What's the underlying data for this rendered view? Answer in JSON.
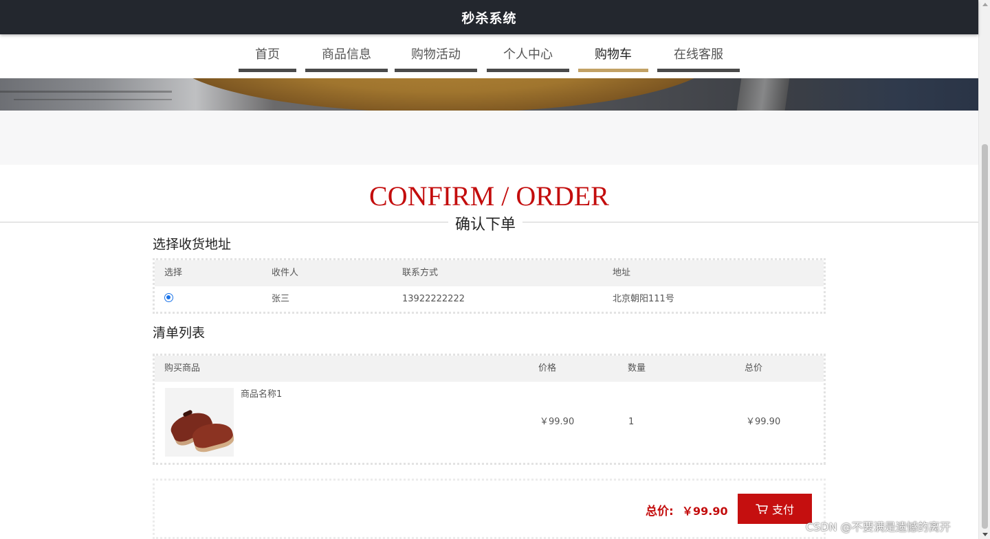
{
  "header": {
    "title": "秒杀系统"
  },
  "nav": {
    "items": [
      {
        "label": "首页",
        "active": false
      },
      {
        "label": "商品信息",
        "active": false
      },
      {
        "label": "购物活动",
        "active": false
      },
      {
        "label": "个人中心",
        "active": false
      },
      {
        "label": "购物车",
        "active": true
      },
      {
        "label": "在线客服",
        "active": false
      }
    ],
    "active_color": "#c2a165",
    "inactive_color": "#4a4a4a"
  },
  "page_heading": {
    "en": "CONFIRM / ORDER",
    "cn": "确认下单"
  },
  "address": {
    "section_title": "选择收货地址",
    "headers": [
      "选择",
      "收件人",
      "联系方式",
      "地址"
    ],
    "rows": [
      {
        "selected": true,
        "recipient": "张三",
        "phone": "13922222222",
        "address": "北京朝阳111号"
      }
    ]
  },
  "order": {
    "section_title": "清单列表",
    "headers": [
      "购买商品",
      "价格",
      "数量",
      "总价"
    ],
    "items": [
      {
        "image_icon": "shoe-image",
        "name": "商品名称1",
        "price": "￥99.90",
        "quantity": "1",
        "subtotal": "￥99.90"
      }
    ]
  },
  "payment": {
    "total_label": "总价:",
    "total_value": "￥99.90",
    "pay_label": "支付",
    "pay_icon": "cart-icon",
    "accent_color": "#c50f0f"
  },
  "watermark": "CSDN @不要满是遗憾的离开"
}
